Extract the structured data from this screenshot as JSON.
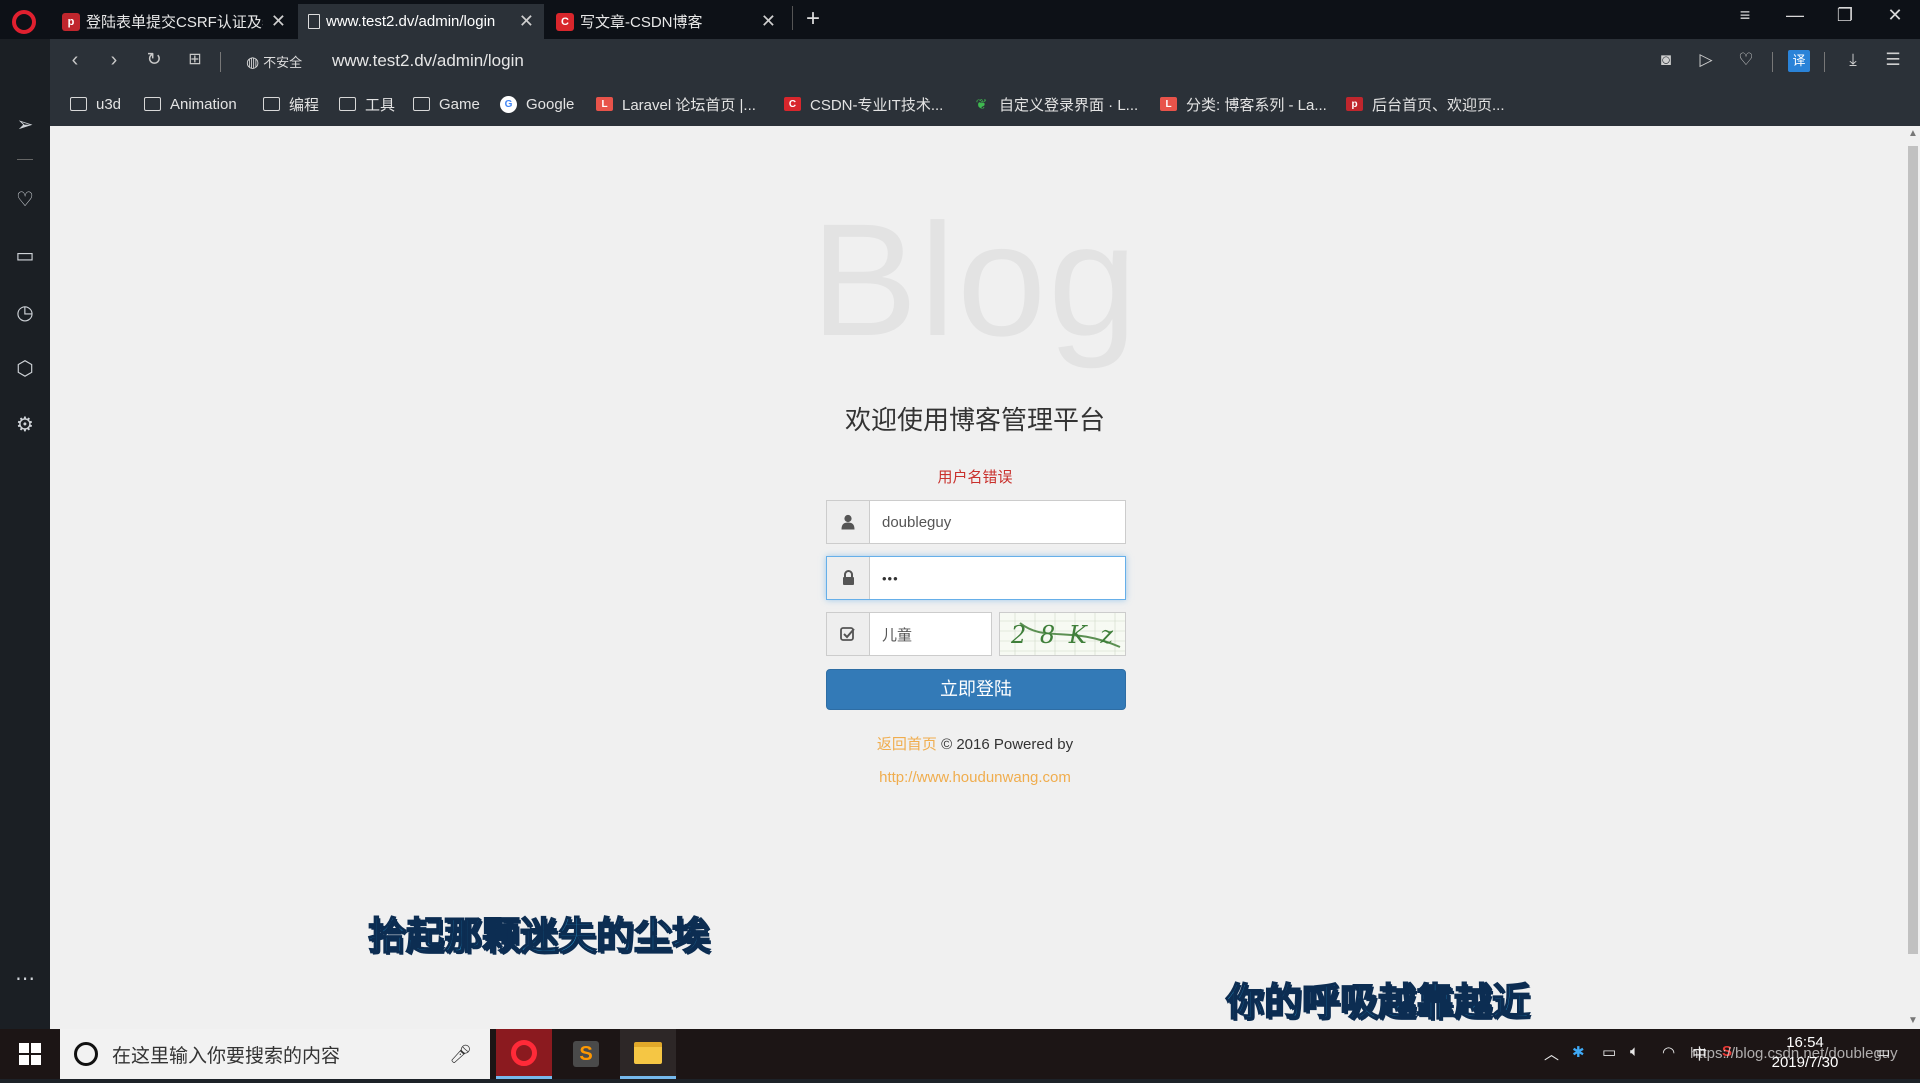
{
  "browser": {
    "tabs": [
      {
        "title": "登陆表单提交CSRF认证及表",
        "favicon": "php-icon",
        "active": false
      },
      {
        "title": "www.test2.dv/admin/login",
        "favicon": "page-icon",
        "active": true
      },
      {
        "title": "写文章-CSDN博客",
        "favicon": "csdn-icon",
        "active": false
      }
    ],
    "security_label": "不安全",
    "url": "www.test2.dv/admin/login",
    "translate_label": "译",
    "bookmarks": [
      {
        "label": "u3d",
        "icon": "folder-icon"
      },
      {
        "label": "Animation",
        "icon": "folder-icon"
      },
      {
        "label": "编程",
        "icon": "folder-icon"
      },
      {
        "label": "工具",
        "icon": "folder-icon"
      },
      {
        "label": "Game",
        "icon": "folder-icon"
      },
      {
        "label": "Google",
        "icon": "google-icon"
      },
      {
        "label": "Laravel 论坛首页 |...",
        "icon": "laravel-icon"
      },
      {
        "label": "CSDN-专业IT技术...",
        "icon": "csdn-icon"
      },
      {
        "label": "自定义登录界面 · L...",
        "icon": "leaf-icon"
      },
      {
        "label": "分类: 博客系列 - La...",
        "icon": "laravel-icon"
      },
      {
        "label": "后台首页、欢迎页...",
        "icon": "php-icon"
      }
    ]
  },
  "login": {
    "brand": "Blog",
    "welcome": "欢迎使用博客管理平台",
    "error": "用户名错误",
    "username_value": "doubleguy",
    "password_mask": "•••",
    "captcha_value": "儿童",
    "captcha_text": "2 8 K z",
    "login_button": "立即登陆",
    "footer_link": "返回首页",
    "footer_text": "© 2016 Powered by",
    "footer_url": "http://www.houdunwang.com"
  },
  "lyrics": {
    "line1": "拾起那颗迷失的尘埃",
    "line2": "你的呼吸越靠越近"
  },
  "taskbar": {
    "search_placeholder": "在这里输入你要搜索的内容",
    "time": "16:54",
    "date": "2019/7/30",
    "ime": "中",
    "watermark": "https://blog.csdn.net/doubleguy"
  },
  "colors": {
    "primary_button": "#337ab7",
    "error": "#c9302c",
    "link": "#f0ad4e",
    "opera_red": "#e0202f"
  }
}
